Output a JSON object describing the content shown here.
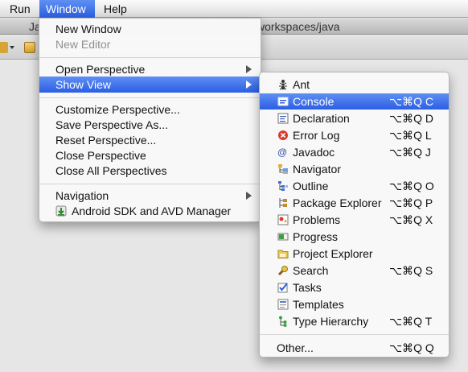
{
  "menubar": {
    "items": [
      {
        "label": "Run"
      },
      {
        "label": "Window"
      },
      {
        "label": "Help"
      }
    ]
  },
  "titlebar": {
    "left_text": "Ja",
    "right_text": "workspaces/java"
  },
  "window_menu": {
    "items": [
      {
        "label": "New Window"
      },
      {
        "label": "New Editor"
      },
      {
        "label": "Open Perspective"
      },
      {
        "label": "Show View"
      },
      {
        "label": "Customize Perspective..."
      },
      {
        "label": "Save Perspective As..."
      },
      {
        "label": "Reset Perspective..."
      },
      {
        "label": "Close Perspective"
      },
      {
        "label": "Close All Perspectives"
      },
      {
        "label": "Navigation"
      },
      {
        "label": "Android SDK and AVD Manager"
      }
    ]
  },
  "show_view_menu": {
    "items": [
      {
        "label": "Ant",
        "shortcut": "",
        "icon": "ant-icon"
      },
      {
        "label": "Console",
        "shortcut": "⌥⌘Q C",
        "icon": "console-icon"
      },
      {
        "label": "Declaration",
        "shortcut": "⌥⌘Q D",
        "icon": "declaration-icon"
      },
      {
        "label": "Error Log",
        "shortcut": "⌥⌘Q L",
        "icon": "error-log-icon"
      },
      {
        "label": "Javadoc",
        "shortcut": "⌥⌘Q J",
        "icon": "javadoc-icon"
      },
      {
        "label": "Navigator",
        "shortcut": "",
        "icon": "navigator-icon"
      },
      {
        "label": "Outline",
        "shortcut": "⌥⌘Q O",
        "icon": "outline-icon"
      },
      {
        "label": "Package Explorer",
        "shortcut": "⌥⌘Q P",
        "icon": "package-explorer-icon"
      },
      {
        "label": "Problems",
        "shortcut": "⌥⌘Q X",
        "icon": "problems-icon"
      },
      {
        "label": "Progress",
        "shortcut": "",
        "icon": "progress-icon"
      },
      {
        "label": "Project Explorer",
        "shortcut": "",
        "icon": "project-explorer-icon"
      },
      {
        "label": "Search",
        "shortcut": "⌥⌘Q S",
        "icon": "search-icon"
      },
      {
        "label": "Tasks",
        "shortcut": "",
        "icon": "tasks-icon"
      },
      {
        "label": "Templates",
        "shortcut": "",
        "icon": "templates-icon"
      },
      {
        "label": "Type Hierarchy",
        "shortcut": "⌥⌘Q T",
        "icon": "type-hierarchy-icon"
      },
      {
        "label": "Other...",
        "shortcut": "⌥⌘Q Q",
        "icon": ""
      }
    ]
  },
  "colors": {
    "highlight": "#3b6ee8",
    "menu_background": "#f8f8f8",
    "disabled_text": "#8f8f8f"
  }
}
